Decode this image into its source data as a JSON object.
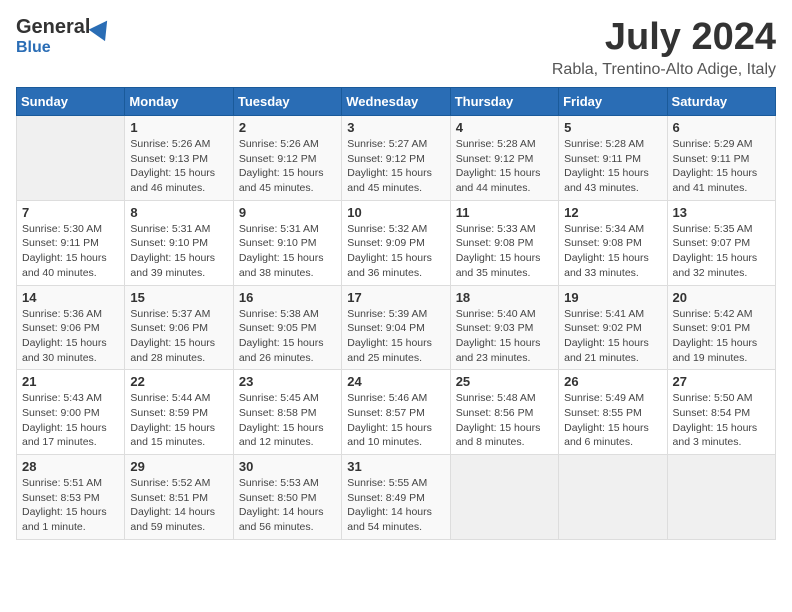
{
  "header": {
    "logo": {
      "general": "General",
      "blue": "Blue"
    },
    "title": "July 2024",
    "location": "Rabla, Trentino-Alto Adige, Italy"
  },
  "calendar": {
    "weekdays": [
      "Sunday",
      "Monday",
      "Tuesday",
      "Wednesday",
      "Thursday",
      "Friday",
      "Saturday"
    ],
    "weeks": [
      [
        {
          "day": "",
          "info": ""
        },
        {
          "day": "1",
          "info": "Sunrise: 5:26 AM\nSunset: 9:13 PM\nDaylight: 15 hours and 46 minutes."
        },
        {
          "day": "2",
          "info": "Sunrise: 5:26 AM\nSunset: 9:12 PM\nDaylight: 15 hours and 45 minutes."
        },
        {
          "day": "3",
          "info": "Sunrise: 5:27 AM\nSunset: 9:12 PM\nDaylight: 15 hours and 45 minutes."
        },
        {
          "day": "4",
          "info": "Sunrise: 5:28 AM\nSunset: 9:12 PM\nDaylight: 15 hours and 44 minutes."
        },
        {
          "day": "5",
          "info": "Sunrise: 5:28 AM\nSunset: 9:11 PM\nDaylight: 15 hours and 43 minutes."
        },
        {
          "day": "6",
          "info": "Sunrise: 5:29 AM\nSunset: 9:11 PM\nDaylight: 15 hours and 41 minutes."
        }
      ],
      [
        {
          "day": "7",
          "info": "Sunrise: 5:30 AM\nSunset: 9:11 PM\nDaylight: 15 hours and 40 minutes."
        },
        {
          "day": "8",
          "info": "Sunrise: 5:31 AM\nSunset: 9:10 PM\nDaylight: 15 hours and 39 minutes."
        },
        {
          "day": "9",
          "info": "Sunrise: 5:31 AM\nSunset: 9:10 PM\nDaylight: 15 hours and 38 minutes."
        },
        {
          "day": "10",
          "info": "Sunrise: 5:32 AM\nSunset: 9:09 PM\nDaylight: 15 hours and 36 minutes."
        },
        {
          "day": "11",
          "info": "Sunrise: 5:33 AM\nSunset: 9:08 PM\nDaylight: 15 hours and 35 minutes."
        },
        {
          "day": "12",
          "info": "Sunrise: 5:34 AM\nSunset: 9:08 PM\nDaylight: 15 hours and 33 minutes."
        },
        {
          "day": "13",
          "info": "Sunrise: 5:35 AM\nSunset: 9:07 PM\nDaylight: 15 hours and 32 minutes."
        }
      ],
      [
        {
          "day": "14",
          "info": "Sunrise: 5:36 AM\nSunset: 9:06 PM\nDaylight: 15 hours and 30 minutes."
        },
        {
          "day": "15",
          "info": "Sunrise: 5:37 AM\nSunset: 9:06 PM\nDaylight: 15 hours and 28 minutes."
        },
        {
          "day": "16",
          "info": "Sunrise: 5:38 AM\nSunset: 9:05 PM\nDaylight: 15 hours and 26 minutes."
        },
        {
          "day": "17",
          "info": "Sunrise: 5:39 AM\nSunset: 9:04 PM\nDaylight: 15 hours and 25 minutes."
        },
        {
          "day": "18",
          "info": "Sunrise: 5:40 AM\nSunset: 9:03 PM\nDaylight: 15 hours and 23 minutes."
        },
        {
          "day": "19",
          "info": "Sunrise: 5:41 AM\nSunset: 9:02 PM\nDaylight: 15 hours and 21 minutes."
        },
        {
          "day": "20",
          "info": "Sunrise: 5:42 AM\nSunset: 9:01 PM\nDaylight: 15 hours and 19 minutes."
        }
      ],
      [
        {
          "day": "21",
          "info": "Sunrise: 5:43 AM\nSunset: 9:00 PM\nDaylight: 15 hours and 17 minutes."
        },
        {
          "day": "22",
          "info": "Sunrise: 5:44 AM\nSunset: 8:59 PM\nDaylight: 15 hours and 15 minutes."
        },
        {
          "day": "23",
          "info": "Sunrise: 5:45 AM\nSunset: 8:58 PM\nDaylight: 15 hours and 12 minutes."
        },
        {
          "day": "24",
          "info": "Sunrise: 5:46 AM\nSunset: 8:57 PM\nDaylight: 15 hours and 10 minutes."
        },
        {
          "day": "25",
          "info": "Sunrise: 5:48 AM\nSunset: 8:56 PM\nDaylight: 15 hours and 8 minutes."
        },
        {
          "day": "26",
          "info": "Sunrise: 5:49 AM\nSunset: 8:55 PM\nDaylight: 15 hours and 6 minutes."
        },
        {
          "day": "27",
          "info": "Sunrise: 5:50 AM\nSunset: 8:54 PM\nDaylight: 15 hours and 3 minutes."
        }
      ],
      [
        {
          "day": "28",
          "info": "Sunrise: 5:51 AM\nSunset: 8:53 PM\nDaylight: 15 hours and 1 minute."
        },
        {
          "day": "29",
          "info": "Sunrise: 5:52 AM\nSunset: 8:51 PM\nDaylight: 14 hours and 59 minutes."
        },
        {
          "day": "30",
          "info": "Sunrise: 5:53 AM\nSunset: 8:50 PM\nDaylight: 14 hours and 56 minutes."
        },
        {
          "day": "31",
          "info": "Sunrise: 5:55 AM\nSunset: 8:49 PM\nDaylight: 14 hours and 54 minutes."
        },
        {
          "day": "",
          "info": ""
        },
        {
          "day": "",
          "info": ""
        },
        {
          "day": "",
          "info": ""
        }
      ]
    ]
  }
}
